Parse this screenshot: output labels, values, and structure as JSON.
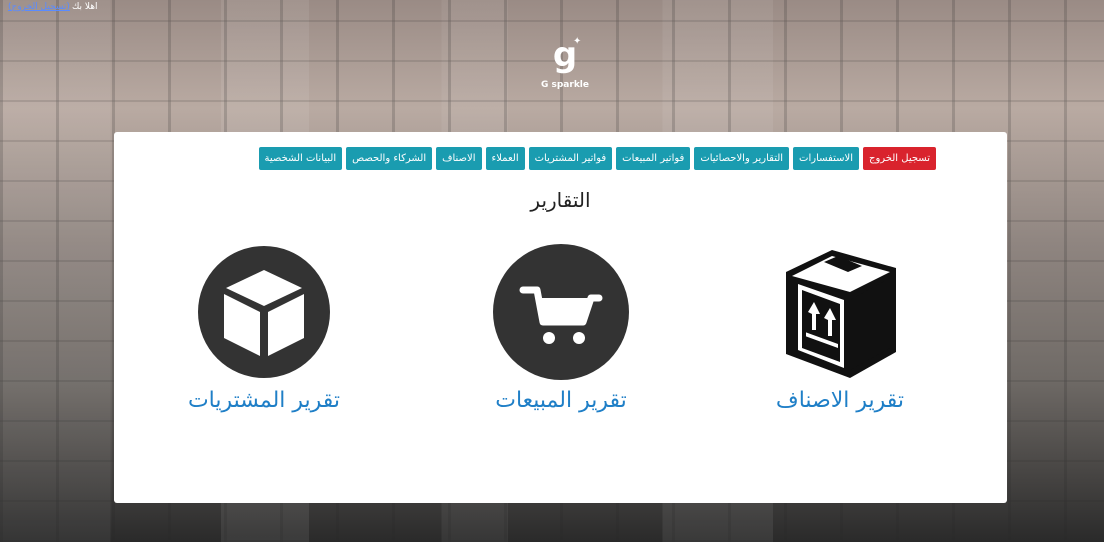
{
  "header": {
    "greeting": "اهلا بك",
    "logout_link": "(تسجيل الخروج)",
    "logo_text": "G sparkle"
  },
  "nav": {
    "items": [
      {
        "label": "البيانات الشخصية"
      },
      {
        "label": "الشركاء والحصص"
      },
      {
        "label": "الاصناف"
      },
      {
        "label": "العملاء"
      },
      {
        "label": "فواتير المشتريات"
      },
      {
        "label": "فواتير المبيعات"
      },
      {
        "label": "التقارير والاحصائيات"
      },
      {
        "label": "الاستفسارات"
      }
    ],
    "logout_label": "تسجيل الخروج"
  },
  "main": {
    "title": "التقارير",
    "cards": [
      {
        "label": "تقرير الاصناف",
        "icon": "box-arrows-icon"
      },
      {
        "label": "تقرير المبيعات",
        "icon": "cart-icon"
      },
      {
        "label": "تقرير المشتريات",
        "icon": "cube-icon"
      }
    ]
  },
  "colors": {
    "nav_button": "#1a9cb0",
    "logout_button": "#d9232d",
    "card_label": "#1f7fc7"
  }
}
